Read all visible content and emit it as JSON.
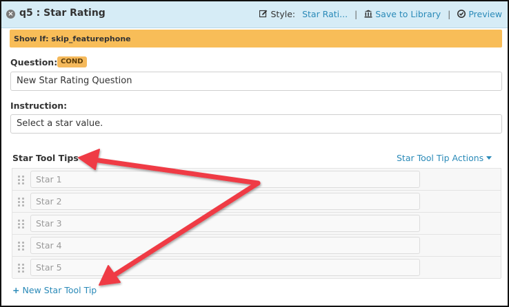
{
  "header": {
    "title": "q5 : Star Rating",
    "style_label": "Style:",
    "style_value": "Star Rati...",
    "save_label": "Save to Library",
    "preview_label": "Preview"
  },
  "banner": {
    "text": "Show If: skip_featurephone"
  },
  "question": {
    "label": "Question:",
    "badge": "COND",
    "value": "New Star Rating Question"
  },
  "instruction": {
    "label": "Instruction:",
    "value": "Select a star value."
  },
  "tooltips": {
    "label": "Star Tool Tips",
    "actions_label": "Star Tool Tip Actions",
    "items": [
      {
        "placeholder": "Star 1"
      },
      {
        "placeholder": "Star 2"
      },
      {
        "placeholder": "Star 3"
      },
      {
        "placeholder": "Star 4"
      },
      {
        "placeholder": "Star 5"
      }
    ],
    "add_label": "New Star Tool Tip"
  },
  "colors": {
    "header_bg": "#d6ecf6",
    "banner_bg": "#f8bd58",
    "link": "#2a8ab8",
    "arrow": "#ef3b45"
  }
}
